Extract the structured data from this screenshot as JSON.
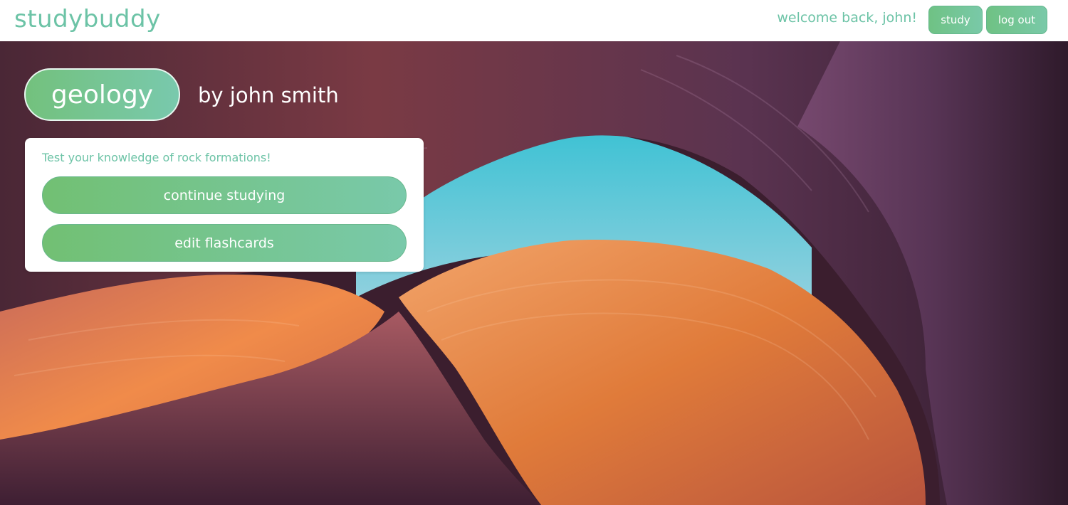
{
  "app": {
    "logo": "studybuddy",
    "welcome": "welcome back, john!",
    "nav": {
      "study_label": "study",
      "logout_label": "log out"
    }
  },
  "deck": {
    "title": "geology",
    "author": "by john smith",
    "description": "Test your knowledge of rock formations!",
    "actions": {
      "continue_label": "continue studying",
      "edit_label": "edit flashcards"
    }
  },
  "colors": {
    "accent": "#6cc3a6",
    "button_gradient_start": "#72c073",
    "button_gradient_end": "#79c9aa"
  },
  "background": {
    "image": "canyon-rock-photo"
  }
}
